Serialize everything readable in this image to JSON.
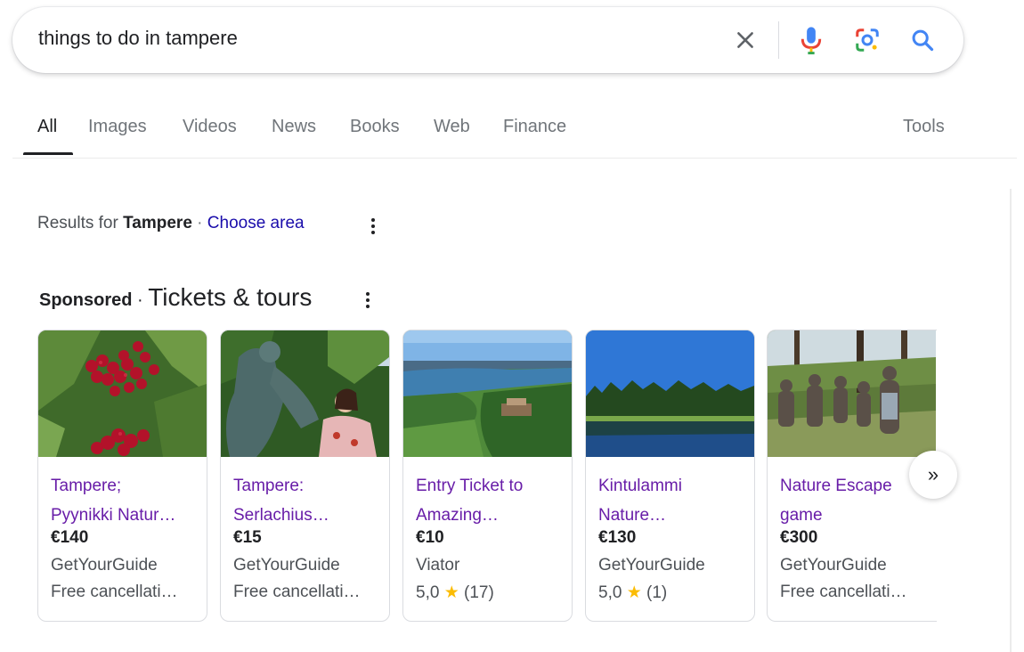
{
  "search": {
    "query": "things to do in tampere"
  },
  "tabs": [
    {
      "label": "All"
    },
    {
      "label": "Images"
    },
    {
      "label": "Videos"
    },
    {
      "label": "News"
    },
    {
      "label": "Books"
    },
    {
      "label": "Web"
    },
    {
      "label": "Finance"
    }
  ],
  "tools_label": "Tools",
  "results_for": {
    "prefix": "Results for ",
    "place": "Tampere",
    "separator": " · ",
    "choose_area": "Choose area"
  },
  "sponsored": {
    "label": "Sponsored",
    "separator": " · ",
    "title": "Tickets & tours"
  },
  "cards": [
    {
      "title_line1": "Tampere;",
      "title_line2": "Pyynikki Natur…",
      "price": "€140",
      "vendor": "GetYourGuide",
      "extra": "Free cancellati…"
    },
    {
      "title_line1": "Tampere:",
      "title_line2": "Serlachius…",
      "price": "€15",
      "vendor": "GetYourGuide",
      "extra": "Free cancellati…"
    },
    {
      "title_line1": "Entry Ticket to",
      "title_line2": "Amazing…",
      "price": "€10",
      "vendor": "Viator",
      "rating": "5,0",
      "star": "★",
      "reviews": "(17)"
    },
    {
      "title_line1": "Kintulammi",
      "title_line2": "Nature…",
      "price": "€130",
      "vendor": "GetYourGuide",
      "rating": "5,0",
      "star": "★",
      "reviews": "(1)"
    },
    {
      "title_line1": "Nature Escape",
      "title_line2": "game",
      "price": "€300",
      "vendor": "GetYourGuide",
      "extra": "Free cancellati…"
    }
  ],
  "next_label": "»",
  "colors": {
    "link": "#1a0dab",
    "visited": "#681da8",
    "star": "#fbbc04"
  }
}
